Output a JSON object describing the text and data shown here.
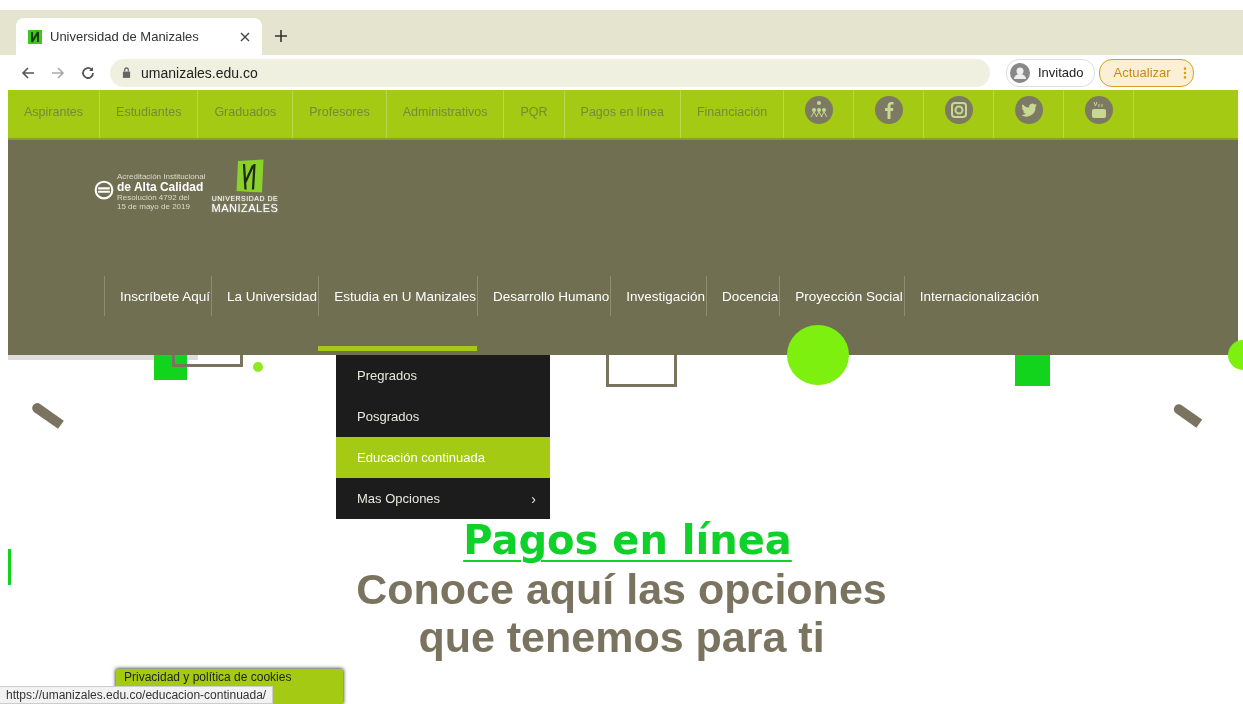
{
  "browser": {
    "tab": {
      "title": "Universidad de Manizales",
      "selected": true
    },
    "url": "umanizales.edu.co",
    "profile": "Invitado",
    "update_button": "Actualizar"
  },
  "top_nav": {
    "items": [
      {
        "kind": "link",
        "label": "Aspirantes"
      },
      {
        "kind": "link",
        "label": "Estudiantes"
      },
      {
        "kind": "link",
        "label": "Graduados"
      },
      {
        "kind": "link",
        "label": "Profesores"
      },
      {
        "kind": "link",
        "label": "Administrativos"
      },
      {
        "kind": "link",
        "label": "PQR"
      },
      {
        "kind": "link",
        "label": "Pagos en línea"
      },
      {
        "kind": "link",
        "label": "Financiación"
      },
      {
        "kind": "people"
      },
      {
        "kind": "facebook"
      },
      {
        "kind": "instagram"
      },
      {
        "kind": "twitter"
      },
      {
        "kind": "youtube"
      }
    ]
  },
  "header": {
    "accreditation": [
      "Acreditación Institucional",
      "de Alta Calidad",
      "Resolución 4792 del",
      "15 de mayo de 2019"
    ],
    "logo_text": [
      "UNIVERSIDAD DE",
      "MANIZALES"
    ],
    "main_nav": [
      {
        "label": "Inscríbete Aquí",
        "expanded": false
      },
      {
        "label": "La Universidad",
        "expanded": false
      },
      {
        "label": "Estudia en U Manizales",
        "expanded": true
      },
      {
        "label": "Desarrollo Humano",
        "expanded": false
      },
      {
        "label": "Investigación",
        "expanded": false
      },
      {
        "label": "Docencia",
        "expanded": false
      },
      {
        "label": "Proyección Social",
        "expanded": false
      },
      {
        "label": "Internacionalización",
        "expanded": false
      }
    ]
  },
  "dropdown": [
    {
      "label": "Pregrados",
      "selected": false
    },
    {
      "label": "Posgrados",
      "selected": false
    },
    {
      "label": "Educación continuada",
      "selected": true
    },
    {
      "label": "Mas Opciones",
      "selected": false,
      "arrow": "›"
    }
  ],
  "hero": {
    "title": "Pagos en línea",
    "subtitle": [
      "Conoce aquí las opciones",
      "que tenemos para ti"
    ]
  },
  "cookie_banner": "Privacidad y política de cookies",
  "status_url": "https://umanizales.edu.co/educacion-continuada/"
}
